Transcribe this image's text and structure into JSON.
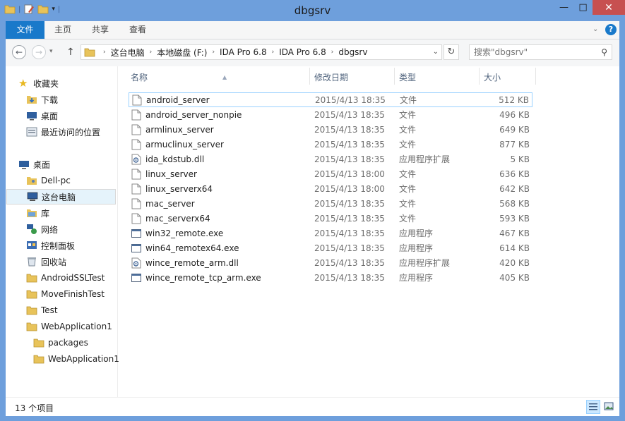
{
  "window": {
    "title": "dbgsrv",
    "min": "—",
    "max": "□",
    "close": "✕"
  },
  "ribbon": {
    "tabs": [
      "文件",
      "主页",
      "共享",
      "查看"
    ],
    "collapse": "⌄",
    "help": "?"
  },
  "address": {
    "back": "←",
    "forward": "→",
    "up": "↑",
    "crumbs": [
      "这台电脑",
      "本地磁盘 (F:)",
      "IDA Pro 6.8",
      "IDA Pro 6.8",
      "dbgsrv"
    ],
    "dropdown": "⌄",
    "refresh": "↻",
    "search_placeholder": "搜索\"dbgsrv\""
  },
  "nav": {
    "favorites_header": "收藏夹",
    "favorites": [
      "下载",
      "桌面",
      "最近访问的位置"
    ],
    "desktop_header": "桌面",
    "items": [
      "Dell-pc",
      "这台电脑",
      "库",
      "网络",
      "控制面板",
      "回收站",
      "AndroidSSLTest",
      "MoveFinishTest",
      "Test",
      "WebApplication1"
    ],
    "sub_items": [
      "packages",
      "WebApplication1"
    ]
  },
  "columns": {
    "name": "名称",
    "date": "修改日期",
    "type": "类型",
    "size": "大小"
  },
  "files": [
    {
      "name": "android_server",
      "date": "2015/4/13 18:35",
      "type": "文件",
      "size": "512 KB",
      "kind": "file"
    },
    {
      "name": "android_server_nonpie",
      "date": "2015/4/13 18:35",
      "type": "文件",
      "size": "496 KB",
      "kind": "file"
    },
    {
      "name": "armlinux_server",
      "date": "2015/4/13 18:35",
      "type": "文件",
      "size": "649 KB",
      "kind": "file"
    },
    {
      "name": "armuclinux_server",
      "date": "2015/4/13 18:35",
      "type": "文件",
      "size": "877 KB",
      "kind": "file"
    },
    {
      "name": "ida_kdstub.dll",
      "date": "2015/4/13 18:35",
      "type": "应用程序扩展",
      "size": "5 KB",
      "kind": "dll"
    },
    {
      "name": "linux_server",
      "date": "2015/4/13 18:00",
      "type": "文件",
      "size": "636 KB",
      "kind": "file"
    },
    {
      "name": "linux_serverx64",
      "date": "2015/4/13 18:00",
      "type": "文件",
      "size": "642 KB",
      "kind": "file"
    },
    {
      "name": "mac_server",
      "date": "2015/4/13 18:35",
      "type": "文件",
      "size": "568 KB",
      "kind": "file"
    },
    {
      "name": "mac_serverx64",
      "date": "2015/4/13 18:35",
      "type": "文件",
      "size": "593 KB",
      "kind": "file"
    },
    {
      "name": "win32_remote.exe",
      "date": "2015/4/13 18:35",
      "type": "应用程序",
      "size": "467 KB",
      "kind": "exe"
    },
    {
      "name": "win64_remotex64.exe",
      "date": "2015/4/13 18:35",
      "type": "应用程序",
      "size": "614 KB",
      "kind": "exe"
    },
    {
      "name": "wince_remote_arm.dll",
      "date": "2015/4/13 18:35",
      "type": "应用程序扩展",
      "size": "420 KB",
      "kind": "dll"
    },
    {
      "name": "wince_remote_tcp_arm.exe",
      "date": "2015/4/13 18:35",
      "type": "应用程序",
      "size": "405 KB",
      "kind": "exe"
    }
  ],
  "status": {
    "count": "13 个项目"
  },
  "colors": {
    "titlebar": "#6e9fdc",
    "file_tab": "#1979ca",
    "close": "#c75050",
    "selection": "#e5f3fb",
    "selection_border": "#99d1ff"
  }
}
